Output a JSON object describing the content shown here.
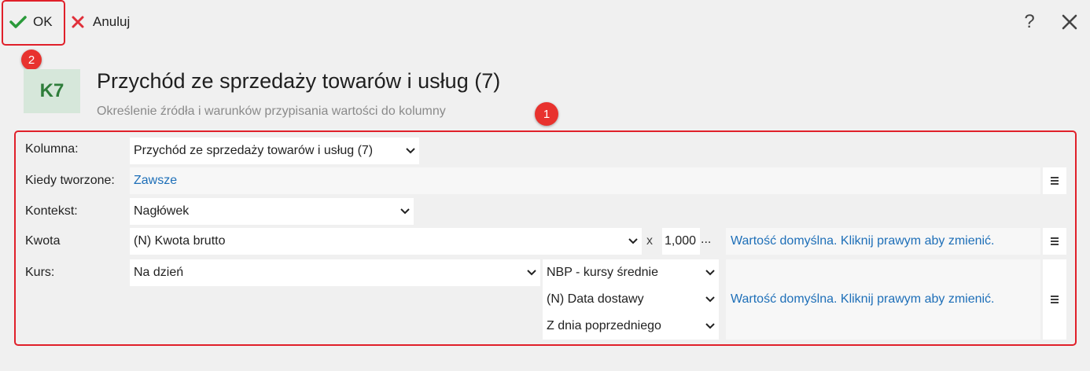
{
  "toolbar": {
    "ok_label": "OK",
    "cancel_label": "Anuluj",
    "help_label": "?"
  },
  "badges": {
    "one": "1",
    "two": "2"
  },
  "header": {
    "tile": "K7",
    "title": "Przychód ze sprzedaży towarów i usług (7)",
    "subtitle": "Określenie źródła i warunków przypisania wartości do kolumny"
  },
  "form": {
    "kolumna": {
      "label": "Kolumna:",
      "value": "Przychód ze sprzedaży towarów i usług (7)"
    },
    "kiedy": {
      "label": "Kiedy tworzone:",
      "value": "Zawsze"
    },
    "kontekst": {
      "label": "Kontekst:",
      "value": "Nagłówek"
    },
    "kwota": {
      "label": "Kwota",
      "value": "(N) Kwota brutto",
      "multiplier_sign": "x",
      "multiplier": "1,000",
      "ellipsis": "...",
      "note": "Wartość domyślna. Kliknij prawym aby zmienić."
    },
    "kurs": {
      "label": "Kurs:",
      "value": "Na dzień",
      "source": "NBP - kursy średnie",
      "date": "(N) Data dostawy",
      "offset": "Z dnia poprzedniego",
      "note": "Wartość domyślna. Kliknij prawym aby zmienić."
    }
  },
  "colors": {
    "accent_green": "#2e7d3a",
    "link_blue": "#1e6fb8",
    "marker_red": "#e0202a"
  }
}
